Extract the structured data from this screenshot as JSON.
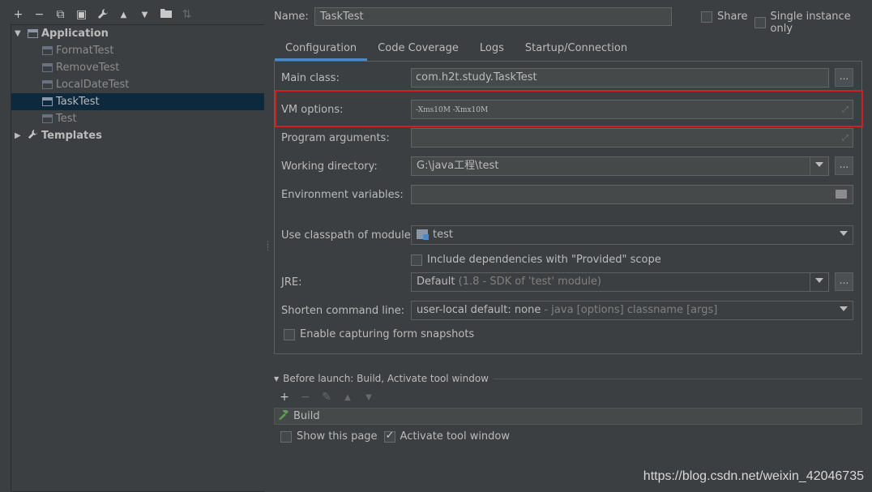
{
  "toolbar": {
    "add": "+",
    "remove": "−",
    "copy": "⧉",
    "save": "▣",
    "edit": "🔧",
    "up": "▲",
    "down": "▼",
    "folder": "📁",
    "sort": "⇅"
  },
  "tree": {
    "application": "Application",
    "children": [
      "FormatTest",
      "RemoveTest",
      "LocalDateTest",
      "TaskTest",
      "Test"
    ],
    "selected": "TaskTest",
    "templates": "Templates"
  },
  "header": {
    "name_label": "Name:",
    "name_value": "TaskTest",
    "share_label": "Share",
    "single_instance_label": "Single instance only"
  },
  "tabs": [
    "Configuration",
    "Code Coverage",
    "Logs",
    "Startup/Connection"
  ],
  "config": {
    "main_class_label": "Main class:",
    "main_class_value": "com.h2t.study.TaskTest",
    "vm_options_label": "VM options:",
    "vm_options_value": "-Xms10M -Xmx10M",
    "program_args_label": "Program arguments:",
    "working_dir_label": "Working directory:",
    "working_dir_value": "G:\\java工程\\test",
    "env_vars_label": "Environment variables:",
    "classpath_label": "Use classpath of module:",
    "classpath_value": "test",
    "include_deps_label": "Include dependencies with \"Provided\" scope",
    "jre_label": "JRE:",
    "jre_value": "Default",
    "jre_detail": "(1.8 - SDK of 'test' module)",
    "shorten_label": "Shorten command line:",
    "shorten_value": "user-local default: none",
    "shorten_detail": "- java [options] classname [args]",
    "snapshots_label": "Enable capturing form snapshots",
    "browse_label": "..."
  },
  "before_launch": {
    "label": "Before launch: Build, Activate tool window",
    "build_item": "Build",
    "show_page_label": "Show this page",
    "activate_label": "Activate tool window"
  },
  "watermark": "https://blog.csdn.net/weixin_42046735",
  "colors": {
    "background": "#3c3f41",
    "selection": "#0d293e",
    "tab_underline": "#4a88c7",
    "highlight_box": "#d11f24"
  }
}
